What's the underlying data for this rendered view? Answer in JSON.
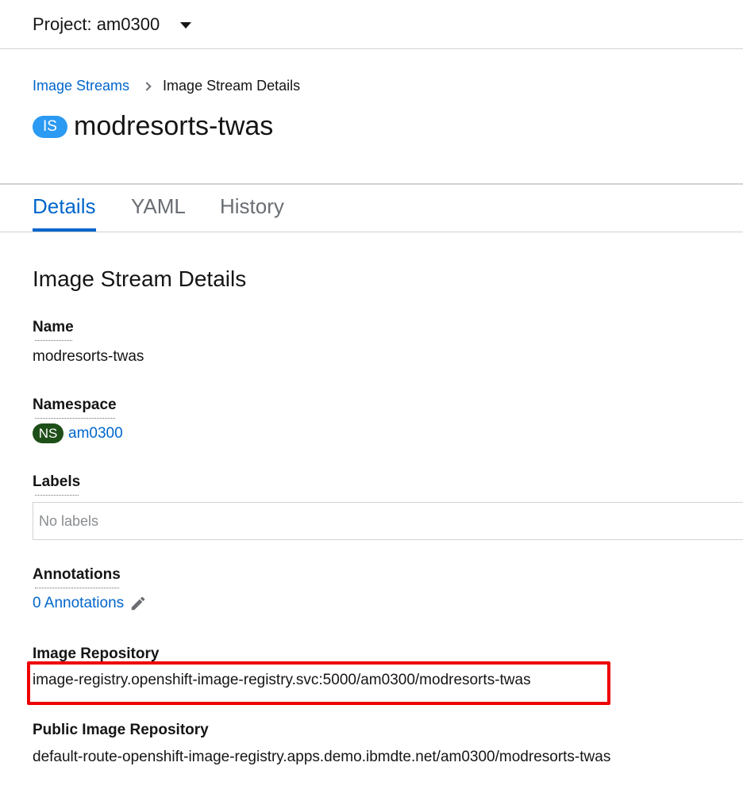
{
  "project_bar": {
    "project_label": "Project: am0300"
  },
  "breadcrumb": {
    "parent": "Image Streams",
    "current": "Image Stream Details"
  },
  "header": {
    "badge": "IS",
    "title": "modresorts-twas"
  },
  "tabs": [
    {
      "label": "Details",
      "active": true
    },
    {
      "label": "YAML",
      "active": false
    },
    {
      "label": "History",
      "active": false
    }
  ],
  "details": {
    "heading": "Image Stream Details",
    "name": {
      "label": "Name",
      "value": "modresorts-twas"
    },
    "namespace": {
      "label": "Namespace",
      "badge": "NS",
      "value": "am0300"
    },
    "labels": {
      "label": "Labels",
      "value": "No labels"
    },
    "annotations": {
      "label": "Annotations",
      "value": "0 Annotations"
    },
    "image_repository": {
      "label": "Image Repository",
      "value": "image-registry.openshift-image-registry.svc:5000/am0300/modresorts-twas"
    },
    "public_image_repository": {
      "label": "Public Image Repository",
      "value": "default-route-openshift-image-registry.apps.demo.ibmdte.net/am0300/modresorts-twas"
    }
  },
  "colors": {
    "link": "#0066cc",
    "is_badge": "#2b9af3",
    "ns_badge": "#1e4f18",
    "highlight": "#ee0000"
  }
}
